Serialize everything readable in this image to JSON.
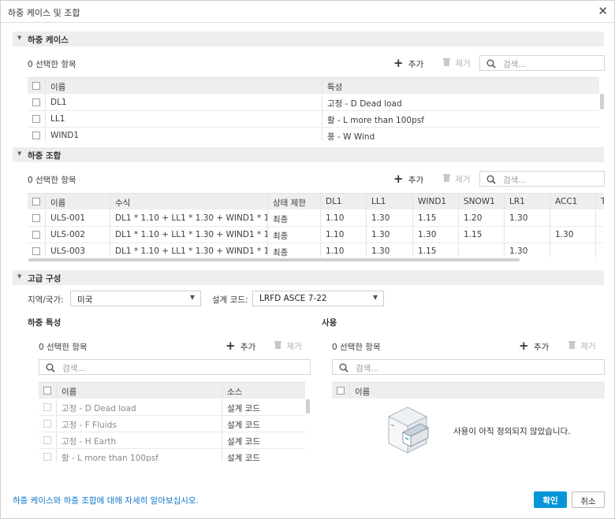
{
  "dialog": {
    "title": "하중 케이스 및 조합",
    "close": "✕"
  },
  "load_cases": {
    "section": "하중 케이스",
    "selected": "0 선택한 항목",
    "add": "추가",
    "remove": "제거",
    "search_placeholder": "검색...",
    "columns": [
      "이름",
      "특성"
    ],
    "rows": [
      [
        "DL1",
        "고정 - D Dead load"
      ],
      [
        "LL1",
        "활 - L more than 100psf"
      ],
      [
        "WIND1",
        "풍 - W Wind"
      ]
    ]
  },
  "load_combos": {
    "section": "하중 조합",
    "selected": "0 선택한 항목",
    "add": "추가",
    "remove": "제거",
    "search_placeholder": "검색...",
    "columns": [
      "이름",
      "수식",
      "상태 제한",
      "DL1",
      "LL1",
      "WIND1",
      "SNOW1",
      "LR1",
      "ACC1",
      "T"
    ],
    "rows": [
      [
        "ULS-001",
        "DL1 * 1.10 + LL1 * 1.30 + WIND1 * 1.15 + ...",
        "최종",
        "1.10",
        "1.30",
        "1.15",
        "1.20",
        "1.30",
        "",
        ""
      ],
      [
        "ULS-002",
        "DL1 * 1.10 + LL1 * 1.30 + WIND1 * 1.30 + ...",
        "최종",
        "1.10",
        "1.30",
        "1.30",
        "1.15",
        "",
        "1.30",
        ""
      ],
      [
        "ULS-003",
        "DL1 * 1.10 + LL1 * 1.30 + WIND1 * 1.15 + ...",
        "최종",
        "1.10",
        "1.30",
        "1.15",
        "",
        "1.30",
        "",
        ""
      ]
    ]
  },
  "advanced": {
    "section": "고급 구성",
    "region_label": "지역/국가:",
    "region_value": "미국",
    "design_code_label": "설계 코드:",
    "design_code_value": "LRFD ASCE 7-22"
  },
  "load_natures": {
    "title": "하중 특성",
    "selected": "0 선택한 항목",
    "add": "추가",
    "remove": "제거",
    "search_placeholder": "검색...",
    "columns": [
      "이름",
      "소스"
    ],
    "rows": [
      [
        "고정 - D Dead load",
        "설계 코드"
      ],
      [
        "고정 - F Fluids",
        "설계 코드"
      ],
      [
        "고정 - H Earth",
        "설계 코드"
      ],
      [
        "활 - L more than 100psf",
        "설계 코드"
      ]
    ]
  },
  "usage": {
    "title": "사용",
    "selected": "0 선택한 항목",
    "add": "추가",
    "remove": "제거",
    "search_placeholder": "검색...",
    "columns": [
      "이름"
    ],
    "empty_message": "사용이 아직 정의되지 않았습니다."
  },
  "footer": {
    "help_link": "하중 케이스와 하중 조합에 대해 자세히 알아보십시오.",
    "ok": "확인",
    "cancel": "취소"
  },
  "colors": {
    "primary": "#0696d7",
    "link": "#0a74c9",
    "header_bg": "#eeeeee"
  }
}
